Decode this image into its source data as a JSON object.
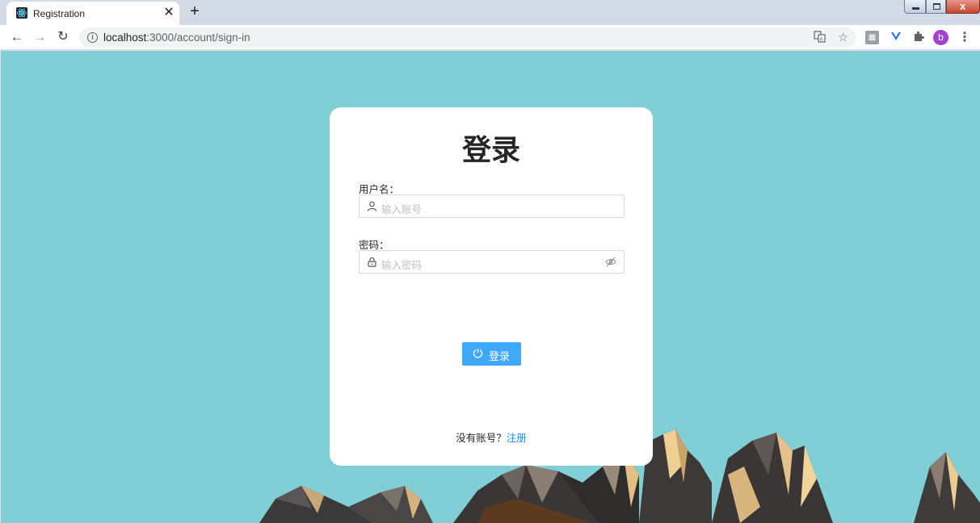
{
  "browser": {
    "tab_title": "Registration",
    "tab_close": "✕",
    "new_tab": "+",
    "url_host": "localhost",
    "url_path": ":3000/account/sign-in",
    "avatar_letter": "b"
  },
  "login": {
    "title": "登录",
    "username_label": "用户名：",
    "username_placeholder": "输入账号",
    "password_label": "密码：",
    "password_placeholder": "输入密码",
    "submit_label": "登录",
    "no_account_text": "没有账号？",
    "register_link": "注册"
  },
  "colors": {
    "background": "#80ced6",
    "primary": "#40a9ff",
    "link": "#1890ff"
  },
  "icons": [
    "user-icon",
    "lock-icon",
    "eye-invisible-icon",
    "power-icon"
  ]
}
